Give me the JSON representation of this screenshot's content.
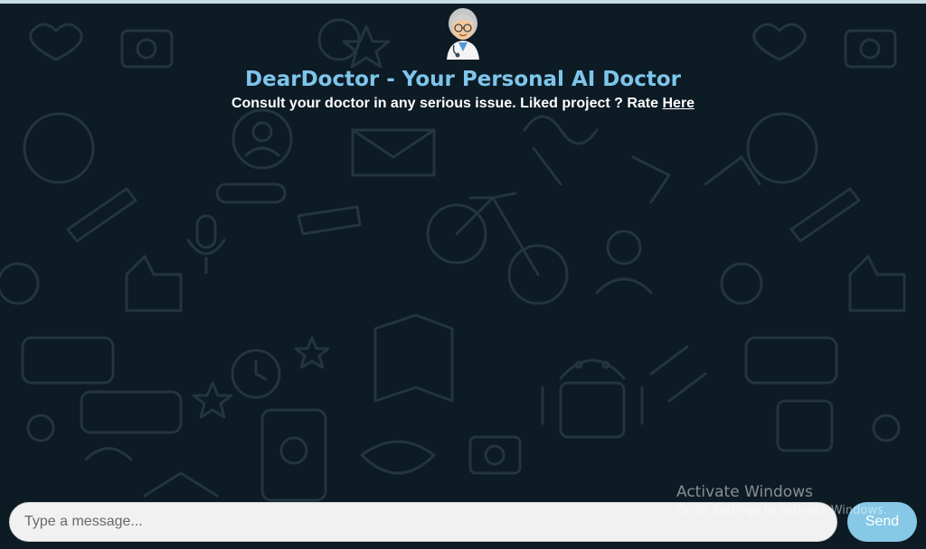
{
  "header": {
    "avatar_icon": "doctor-emoji-icon",
    "title": "DearDoctor - Your Personal AI Doctor",
    "subtitle_text": "Consult your doctor in any serious issue. Liked project ? Rate ",
    "rate_link": "Here"
  },
  "composer": {
    "placeholder": "Type a message...",
    "value": "",
    "send_label": "Send"
  },
  "os_watermark": {
    "title": "Activate Windows",
    "subtitle": "Go to Settings to activate Windows."
  },
  "colors": {
    "background": "#0c1b24",
    "title": "#7ec5ec",
    "send_button": "#86c8e6",
    "input_bg": "#f1f1f1"
  }
}
